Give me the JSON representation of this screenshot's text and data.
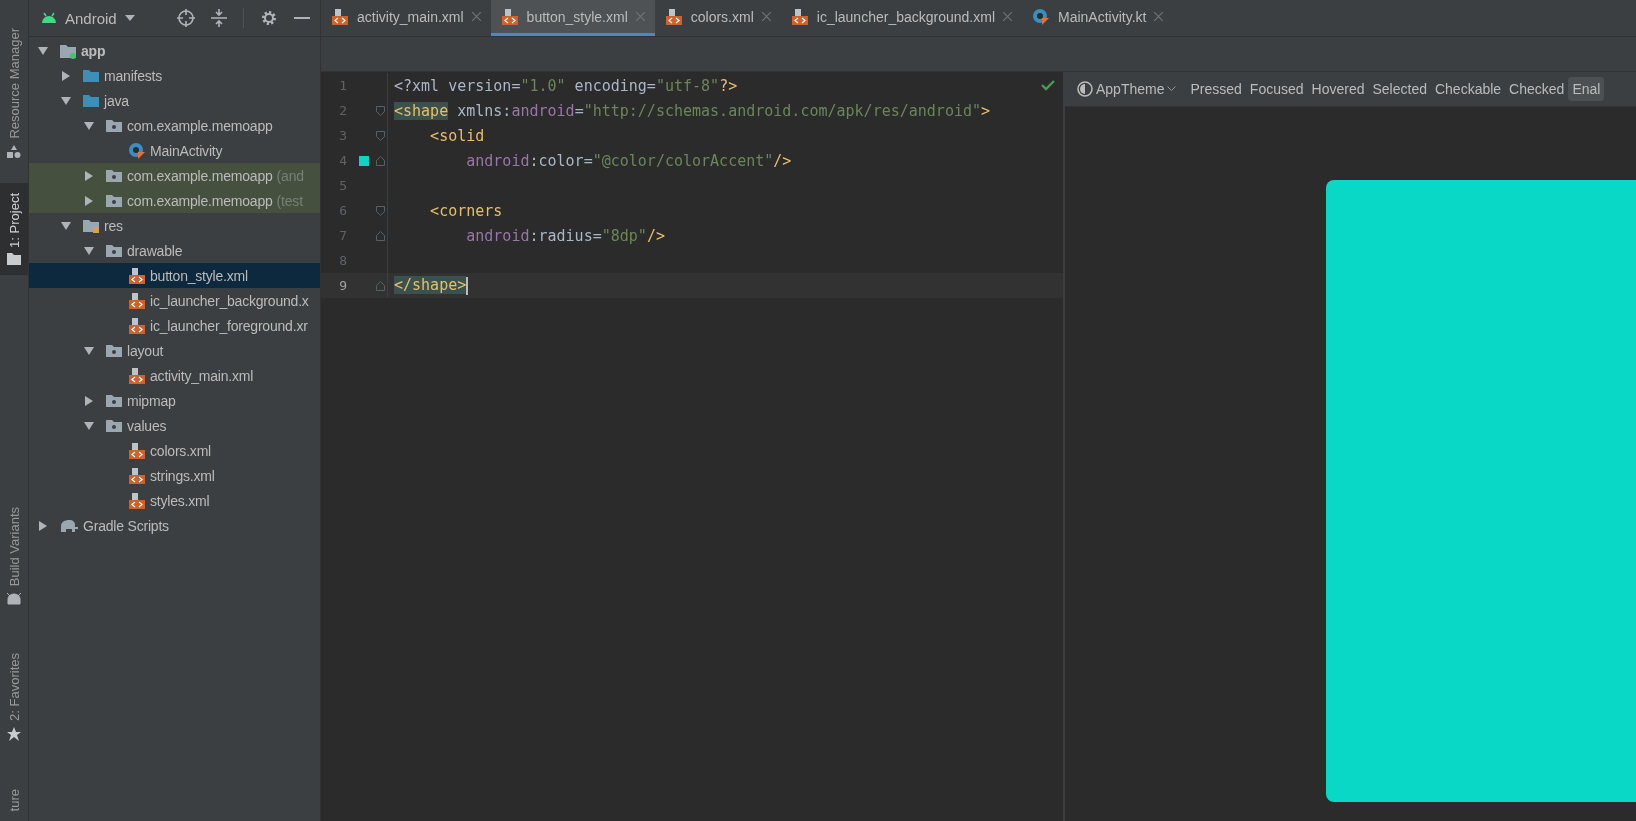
{
  "side_strip": {
    "top": [
      {
        "label": "Resource Manager",
        "kind": "shapes",
        "selected": false
      },
      {
        "label": "1: Project",
        "kind": "folder",
        "selected": true
      }
    ],
    "bottom": [
      {
        "label": "Build Variants",
        "kind": "android",
        "selected": false
      },
      {
        "label": "2: Favorites",
        "kind": "star",
        "selected": false
      },
      {
        "label": "ture",
        "kind": "plain",
        "selected": false
      }
    ]
  },
  "project_panel": {
    "view": "Android",
    "tree": [
      {
        "label": "app",
        "kind": "module",
        "expanded": true,
        "selected": false,
        "highlighted": false,
        "children": [
          {
            "label": "manifests",
            "kind": "folder",
            "expanded": false,
            "selected": false,
            "highlighted": false
          },
          {
            "label": "java",
            "kind": "folder",
            "expanded": true,
            "selected": false,
            "highlighted": false,
            "children": [
              {
                "label": "com.example.memoapp",
                "kind": "package",
                "expanded": true,
                "selected": false,
                "highlighted": false,
                "children": [
                  {
                    "label": "MainActivity",
                    "kind": "kotlin",
                    "selected": false,
                    "highlighted": false
                  }
                ]
              },
              {
                "label": "com.example.memoapp",
                "suffix": "(and",
                "kind": "package",
                "expanded": false,
                "selected": false,
                "highlighted": true
              },
              {
                "label": "com.example.memoapp",
                "suffix": "(test",
                "kind": "package",
                "expanded": false,
                "selected": false,
                "highlighted": true
              }
            ]
          },
          {
            "label": "res",
            "kind": "res",
            "expanded": true,
            "selected": false,
            "highlighted": false,
            "children": [
              {
                "label": "drawable",
                "kind": "package",
                "expanded": true,
                "selected": false,
                "highlighted": false,
                "children": [
                  {
                    "label": "button_style.xml",
                    "kind": "xml",
                    "selected": true,
                    "highlighted": false
                  },
                  {
                    "label": "ic_launcher_background.x",
                    "kind": "xml",
                    "selected": false,
                    "highlighted": false
                  },
                  {
                    "label": "ic_launcher_foreground.xr",
                    "kind": "xml",
                    "selected": false,
                    "highlighted": false
                  }
                ]
              },
              {
                "label": "layout",
                "kind": "package",
                "expanded": true,
                "selected": false,
                "highlighted": false,
                "children": [
                  {
                    "label": "activity_main.xml",
                    "kind": "xml",
                    "selected": false,
                    "highlighted": false
                  }
                ]
              },
              {
                "label": "mipmap",
                "kind": "package",
                "expanded": false,
                "selected": false,
                "highlighted": false
              },
              {
                "label": "values",
                "kind": "package",
                "expanded": true,
                "selected": false,
                "highlighted": false,
                "children": [
                  {
                    "label": "colors.xml",
                    "kind": "xml",
                    "selected": false,
                    "highlighted": false
                  },
                  {
                    "label": "strings.xml",
                    "kind": "xml",
                    "selected": false,
                    "highlighted": false
                  },
                  {
                    "label": "styles.xml",
                    "kind": "xml",
                    "selected": false,
                    "highlighted": false
                  }
                ]
              }
            ]
          }
        ]
      },
      {
        "label": "Gradle Scripts",
        "kind": "gradle",
        "expanded": false,
        "selected": false,
        "highlighted": false
      }
    ]
  },
  "tabs": [
    {
      "label": "activity_main.xml",
      "kind": "xml",
      "selected": false
    },
    {
      "label": "button_style.xml",
      "kind": "xml",
      "selected": true
    },
    {
      "label": "colors.xml",
      "kind": "xml",
      "selected": false
    },
    {
      "label": "ic_launcher_background.xml",
      "kind": "xml",
      "selected": false
    },
    {
      "label": "MainActivity.kt",
      "kind": "kotlin",
      "selected": false
    }
  ],
  "editor": {
    "lines": [
      {
        "number": "1",
        "current": false,
        "kind": "plain",
        "tokens": [
          {
            "kind": "plain",
            "text": "<?xml version="
          },
          {
            "kind": "string",
            "text": "\"1.0\""
          },
          {
            "kind": "plain",
            "text": " encoding="
          },
          {
            "kind": "string",
            "text": "\"utf-8\""
          },
          {
            "kind": "tag",
            "text": "?>"
          }
        ]
      },
      {
        "number": "2",
        "current": false,
        "kind": "fold-start",
        "tokens": [
          {
            "kind": "tag",
            "text": "<shape",
            "matched": true
          },
          {
            "kind": "plain",
            "text": " xmlns:"
          },
          {
            "kind": "ns",
            "text": "android"
          },
          {
            "kind": "plain",
            "text": "="
          },
          {
            "kind": "string",
            "text": "\"http://schemas.android.com/apk/res/android\""
          },
          {
            "kind": "tag",
            "text": ">"
          }
        ]
      },
      {
        "number": "3",
        "current": false,
        "kind": "fold-start",
        "tokens": [
          {
            "kind": "tag",
            "text": "    <solid"
          }
        ]
      },
      {
        "number": "4",
        "current": false,
        "kind": "fold-end",
        "color": "#0bd5c3",
        "tokens": [
          {
            "kind": "ns",
            "text": "        android"
          },
          {
            "kind": "plain",
            "text": ":color="
          },
          {
            "kind": "string",
            "text": "\"@color/colorAccent\""
          },
          {
            "kind": "tag",
            "text": "/>"
          }
        ]
      },
      {
        "number": "5",
        "current": false,
        "kind": "plain"
      },
      {
        "number": "6",
        "current": false,
        "kind": "fold-start",
        "tokens": [
          {
            "kind": "tag",
            "text": "    <corners"
          }
        ]
      },
      {
        "number": "7",
        "current": false,
        "kind": "fold-end",
        "tokens": [
          {
            "kind": "ns",
            "text": "        android"
          },
          {
            "kind": "plain",
            "text": ":radius="
          },
          {
            "kind": "string",
            "text": "\"8dp\""
          },
          {
            "kind": "tag",
            "text": "/>"
          }
        ]
      },
      {
        "number": "8",
        "current": false,
        "kind": "plain"
      },
      {
        "number": "9",
        "current": true,
        "kind": "fold-end",
        "tokens": [
          {
            "kind": "tag",
            "text": "</shape>",
            "matched": true
          }
        ]
      }
    ],
    "no_problems": true
  },
  "preview": {
    "theme": "AppTheme",
    "states": [
      {
        "label": "Pressed",
        "selected": false
      },
      {
        "label": "Focused",
        "selected": false
      },
      {
        "label": "Hovered",
        "selected": false
      },
      {
        "label": "Selected",
        "selected": false
      },
      {
        "label": "Checkable",
        "selected": false
      },
      {
        "label": "Checked",
        "selected": false
      },
      {
        "label": "Enal",
        "selected": true
      }
    ],
    "color": "#08d8c5"
  }
}
